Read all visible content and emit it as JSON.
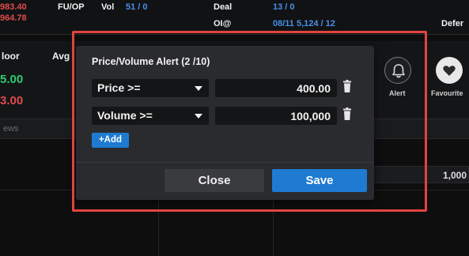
{
  "background": {
    "top_bar": {
      "price_line1": "983.40",
      "price_line2": "964.78",
      "fu_op": "FU/OP",
      "vol_label": "Vol",
      "vol_value": "51 / 0",
      "deal_label": "Deal",
      "deal_value": "13 / 0",
      "oi_label": "OI@",
      "oi_value": "08/11  5,124 / 12",
      "defer_label": "Defer"
    },
    "info_row": {
      "floor_label": "loor",
      "avg_label": "Avg",
      "floor_value1": "5.00",
      "floor_value2": "3.00"
    },
    "news_label": "ews",
    "right_value": "1,000",
    "alert_label": "Alert",
    "favourite_label": "Favourite"
  },
  "modal": {
    "title": "Price/Volume Alert (2 /10)",
    "rows": [
      {
        "field": "Price >=",
        "value": "400.00"
      },
      {
        "field": "Volume >=",
        "value": "100,000"
      }
    ],
    "add_label": "+Add",
    "close_label": "Close",
    "save_label": "Save"
  },
  "colors": {
    "highlight": "#e2443f",
    "primary_button": "#1e7bd1",
    "modal_bg": "#2a2b2e"
  },
  "icons": [
    "bell-icon",
    "heart-icon",
    "trash-icon",
    "caret-down-icon"
  ]
}
